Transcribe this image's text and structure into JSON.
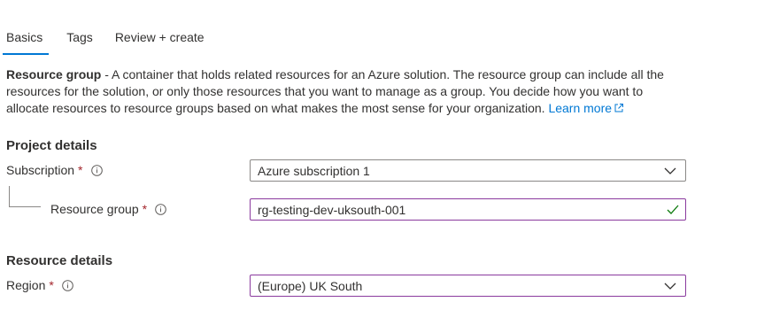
{
  "tabs": [
    {
      "label": "Basics",
      "active": true
    },
    {
      "label": "Tags",
      "active": false
    },
    {
      "label": "Review + create",
      "active": false
    }
  ],
  "description": {
    "bold": "Resource group",
    "text": " - A container that holds related resources for an Azure solution. The resource group can include all the resources for the solution, or only those resources that you want to manage as a group. You decide how you want to allocate resources to resource groups based on what makes the most sense for your organization. ",
    "link": "Learn more"
  },
  "project_details": {
    "heading": "Project details",
    "subscription": {
      "label": "Subscription",
      "required_mark": "*",
      "value": "Azure subscription 1"
    },
    "resource_group": {
      "label": "Resource group",
      "required_mark": "*",
      "value": "rg-testing-dev-uksouth-001",
      "valid": true
    }
  },
  "resource_details": {
    "heading": "Resource details",
    "region": {
      "label": "Region",
      "required_mark": "*",
      "value": "(Europe) UK South"
    }
  },
  "colors": {
    "accent": "#0078d4",
    "required": "#a4262c",
    "focus_border": "#8a3a9e",
    "valid_check": "#107c10"
  },
  "icons": {
    "info": "info-icon",
    "external": "external-link-icon",
    "dropdown": "chevron-down-icon",
    "valid": "checkmark-icon"
  }
}
